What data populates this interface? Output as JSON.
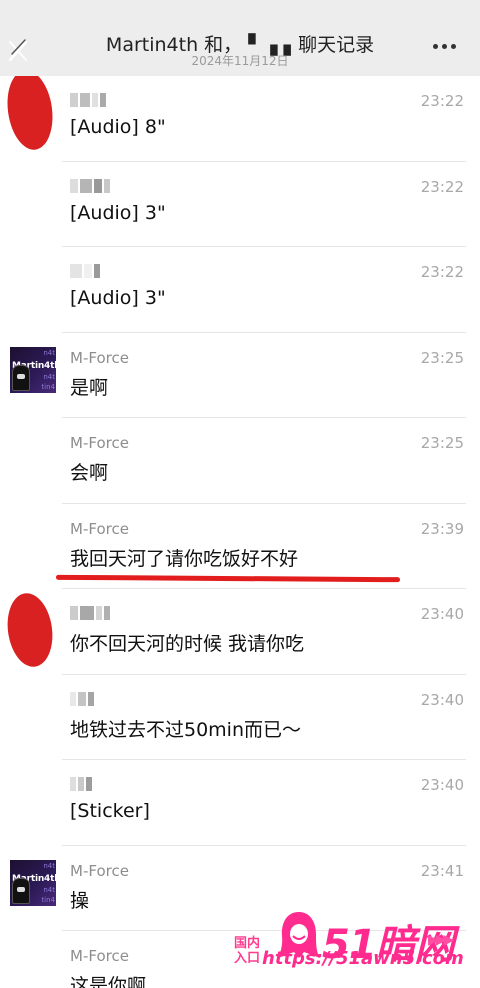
{
  "header": {
    "title": "Martin4th 和， ▘▗ ▖聊天记录",
    "subtitle": "2024年11月12日"
  },
  "messages": [
    {
      "sender": "",
      "time": "23:22",
      "text": "[Audio]  8\""
    },
    {
      "sender": "",
      "time": "23:22",
      "text": "[Audio]  3\""
    },
    {
      "sender": "",
      "time": "23:22",
      "text": "[Audio]  3\""
    },
    {
      "sender": "M-Force",
      "time": "23:25",
      "text": "是啊"
    },
    {
      "sender": "M-Force",
      "time": "23:25",
      "text": "会啊"
    },
    {
      "sender": "M-Force",
      "time": "23:39",
      "text": "我回天河了请你吃饭好不好"
    },
    {
      "sender": "",
      "time": "23:40",
      "text": "你不回天河的时候 我请你吃"
    },
    {
      "sender": "",
      "time": "23:40",
      "text": "地铁过去不过50min而已～"
    },
    {
      "sender": "",
      "time": "23:40",
      "text": "[Sticker]"
    },
    {
      "sender": "M-Force",
      "time": "23:41",
      "text": "操"
    },
    {
      "sender": "M-Force",
      "time": "",
      "text": "这是你啊"
    }
  ],
  "avatar_text": "Martin4th",
  "watermark": {
    "brand": "51暗网",
    "entry": "国内入口",
    "url": "https://51awn5.com"
  },
  "colors": {
    "page_bg": "#ededed",
    "redaction": "#d92121",
    "watermark_pink": "#ff2b8f"
  }
}
